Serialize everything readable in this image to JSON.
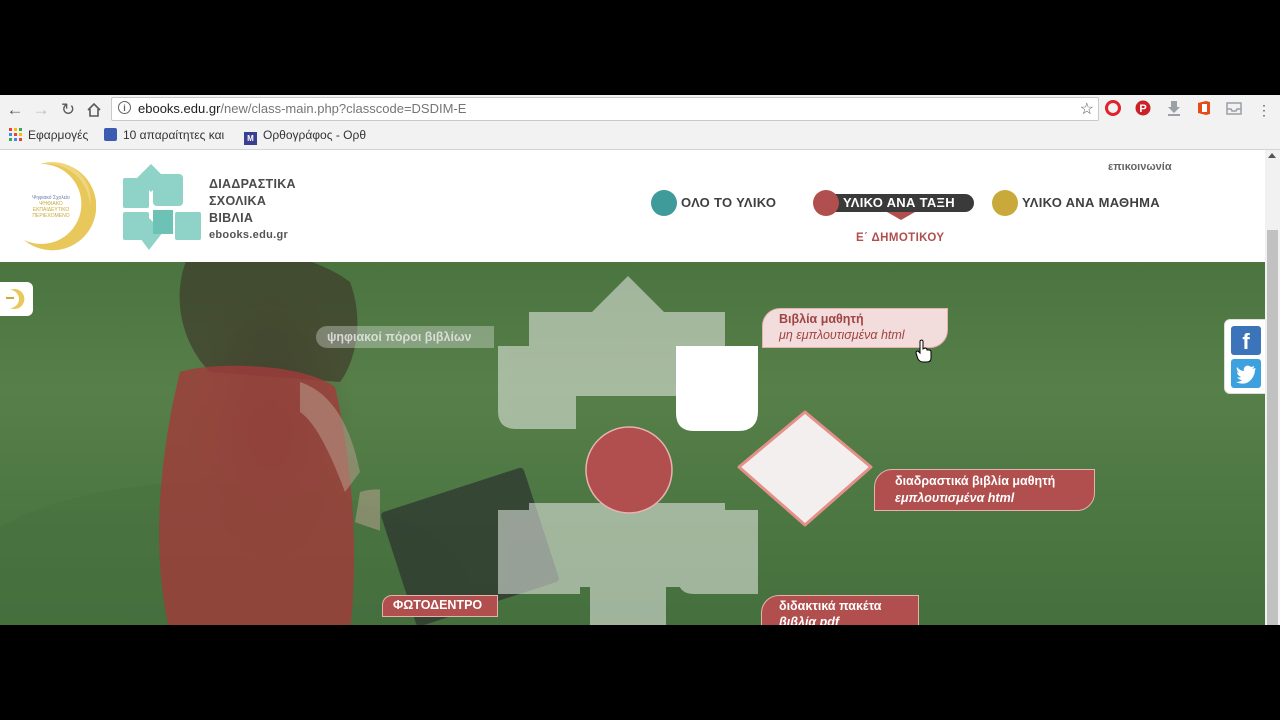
{
  "browser": {
    "url_host": "ebooks.edu.gr",
    "url_path": "/new/class-main.php?classcode=DSDIM-E",
    "bookmarks": [
      {
        "label": "Εφαρμογές"
      },
      {
        "label": "10 απαραίτητες και"
      },
      {
        "label": "Ορθογράφος - Ορθ"
      }
    ]
  },
  "header": {
    "contact": "επικοινωνία",
    "brand_lines": [
      "ΔΙΑΔΡΑΣΤΙΚΑ",
      "ΣΧΟΛΙΚΑ",
      "ΒΙΒΛΙΑ"
    ],
    "brand_domain": "ebooks.edu.gr",
    "badge_text": [
      "Ψηφιακό Σχολείο",
      "ΨΗΦΙΑΚΟ",
      "ΕΚΠΑΙΔΕΥΤΙΚΟ",
      "ΠΕΡΙΕΧΟΜΕΝΟ"
    ]
  },
  "menu": {
    "items": [
      {
        "label": "ΟΛΟ ΤΟ ΥΛΙΚΟ",
        "color": "#3f9a9a"
      },
      {
        "label": "ΥΛΙΚΟ ΑΝΑ ΤΑΞΗ",
        "color": "#b14e4e",
        "active": true
      },
      {
        "label": "ΥΛΙΚΟ ΑΝΑ ΜΑΘΗΜΑ",
        "color": "#c9a93a"
      }
    ],
    "active_sub": "Ε΄ ΔΗΜΟΤΙΚΟΥ"
  },
  "hero": {
    "resources_label": "ψηφιακοί πόροι βιβλίων",
    "student_books": {
      "title": "Βιβλία μαθητή",
      "subtitle": "μη εμπλουτισμένα html"
    },
    "interactive_books": {
      "title": "διαδραστικά βιβλία μαθητή",
      "subtitle": "εμπλουτισμένα html"
    },
    "teaching_packs": {
      "title": "διδακτικά πακέτα",
      "subtitle": "βιβλία pdf"
    },
    "photo_tree": "ΦΩΤΟΔΕΝΤΡΟ"
  },
  "social": {
    "facebook": "f"
  },
  "colors": {
    "accent_red": "#b14e4e",
    "teal": "#3f9a9a",
    "gold": "#c9a93a",
    "petal": "#e9ece8"
  }
}
